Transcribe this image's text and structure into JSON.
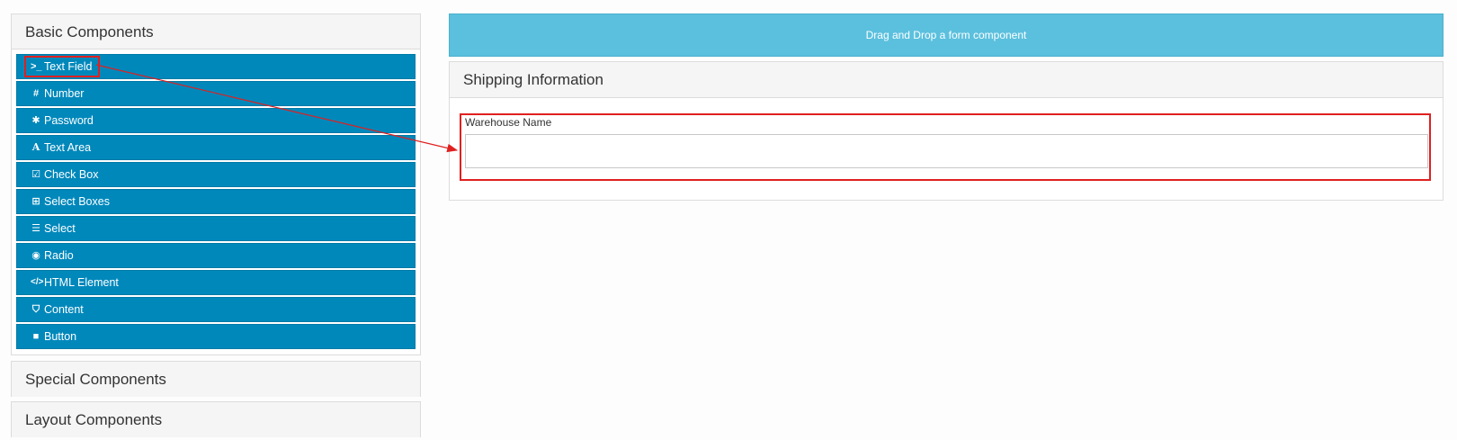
{
  "sidebar": {
    "basic_title": "Basic Components",
    "special_title": "Special Components",
    "layout_title": "Layout Components",
    "components": [
      {
        "label": "Text Field",
        "icon": "terminal-icon"
      },
      {
        "label": "Number",
        "icon": "hashtag-icon"
      },
      {
        "label": "Password",
        "icon": "asterisk-icon"
      },
      {
        "label": "Text Area",
        "icon": "font-icon"
      },
      {
        "label": "Check Box",
        "icon": "check-square-icon"
      },
      {
        "label": "Select Boxes",
        "icon": "plus-square-icon"
      },
      {
        "label": "Select",
        "icon": "table-list-icon"
      },
      {
        "label": "Radio",
        "icon": "dot-circle-icon"
      },
      {
        "label": "HTML Element",
        "icon": "code-icon"
      },
      {
        "label": "Content",
        "icon": "html5-icon"
      },
      {
        "label": "Button",
        "icon": "stop-icon"
      }
    ]
  },
  "main": {
    "dropzone_text": "Drag and Drop a form component",
    "panel_title": "Shipping Information",
    "field_label": "Warehouse Name",
    "field_value": ""
  },
  "colors": {
    "component_bg": "#0088bb",
    "dropzone_bg": "#5bc0de",
    "annotation": "#e02020"
  }
}
